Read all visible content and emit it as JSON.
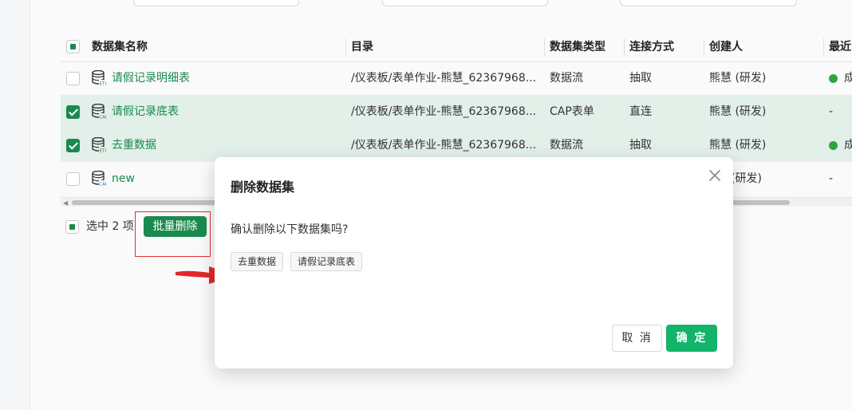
{
  "table": {
    "headers": {
      "name": "数据集名称",
      "dir": "目录",
      "type": "数据集类型",
      "conn": "连接方式",
      "creator": "创建人",
      "recent": "最近"
    },
    "rows": [
      {
        "name": "请假记录明细表",
        "dir": "/仪表板/表单作业-熊慧_62367968...",
        "type": "数据流",
        "conn": "抽取",
        "creator": "熊慧 (研发)",
        "status": "成",
        "checked": false,
        "icon": "database-etl-icon"
      },
      {
        "name": "请假记录底表",
        "dir": "/仪表板/表单作业-熊慧_62367968...",
        "type": "CAP表单",
        "conn": "直连",
        "creator": "熊慧 (研发)",
        "status": "-",
        "checked": true,
        "icon": "database-cap-icon"
      },
      {
        "name": "去重数据",
        "dir": "/仪表板/表单作业-熊慧_62367968...",
        "type": "数据流",
        "conn": "抽取",
        "creator": "熊慧 (研发)",
        "status": "成",
        "checked": true,
        "icon": "database-etl-icon"
      },
      {
        "name": "new",
        "dir": "",
        "type": "",
        "conn": "",
        "creator": "(研发)",
        "status": "-",
        "checked": false,
        "icon": "database-cap-icon"
      }
    ]
  },
  "footer": {
    "selected_text": "选中 2 项",
    "batch_delete_label": "批量删除"
  },
  "modal": {
    "title": "删除数据集",
    "message": "确认删除以下数据集吗?",
    "tags": [
      "去重数据",
      "请假记录底表"
    ],
    "cancel_label": "取 消",
    "ok_label": "确 定"
  },
  "colors": {
    "accent": "#1b8a4f",
    "ok_button": "#12b469",
    "annotation_red": "#e03030",
    "selected_row": "#e3efe9"
  }
}
